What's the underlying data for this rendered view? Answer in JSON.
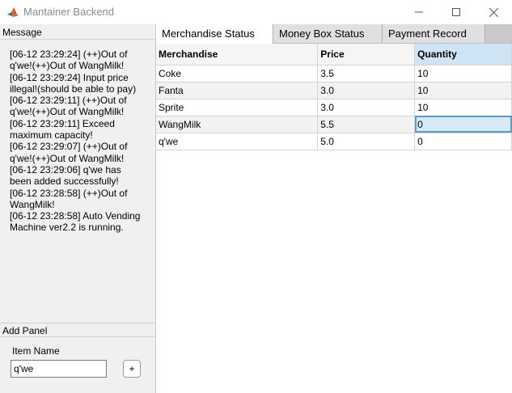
{
  "window": {
    "title": "Mantainer Backend"
  },
  "message_panel": {
    "title": "Message",
    "lines": [
      "[06-12 23:29:24] (++)Out of",
      "q'we!(++)Out of WangMilk!",
      "[06-12 23:29:24] Input price",
      "illegal!(should be able to pay)",
      "[06-12 23:29:11] (++)Out of",
      "q'we!(++)Out of WangMilk!",
      "[06-12 23:29:11] Exceed",
      "maximum capacity!",
      "[06-12 23:29:07] (++)Out of",
      "q'we!(++)Out of WangMilk!",
      "[06-12 23:29:06] q'we has",
      "been added successfully!",
      "[06-12 23:28:58] (++)Out of",
      "WangMilk!",
      "[06-12 23:28:58] Auto Vending",
      "Machine ver2.2 is running."
    ]
  },
  "add_panel": {
    "title": "Add Panel",
    "item_name_label": "Item Name",
    "item_name_value": "q'we",
    "add_button_label": "+"
  },
  "tabs": [
    {
      "label": "Merchandise Status"
    },
    {
      "label": "Money Box Status"
    },
    {
      "label": "Payment Record"
    }
  ],
  "table": {
    "columns": [
      "Merchandise",
      "Price",
      "Quantity"
    ],
    "rows": [
      [
        "Coke",
        "3.5",
        "10"
      ],
      [
        "Fanta",
        "3.0",
        "10"
      ],
      [
        "Sprite",
        "3.0",
        "10"
      ],
      [
        "WangMilk",
        "5.5",
        "0"
      ],
      [
        "q'we",
        "5.0",
        "0"
      ]
    ]
  }
}
